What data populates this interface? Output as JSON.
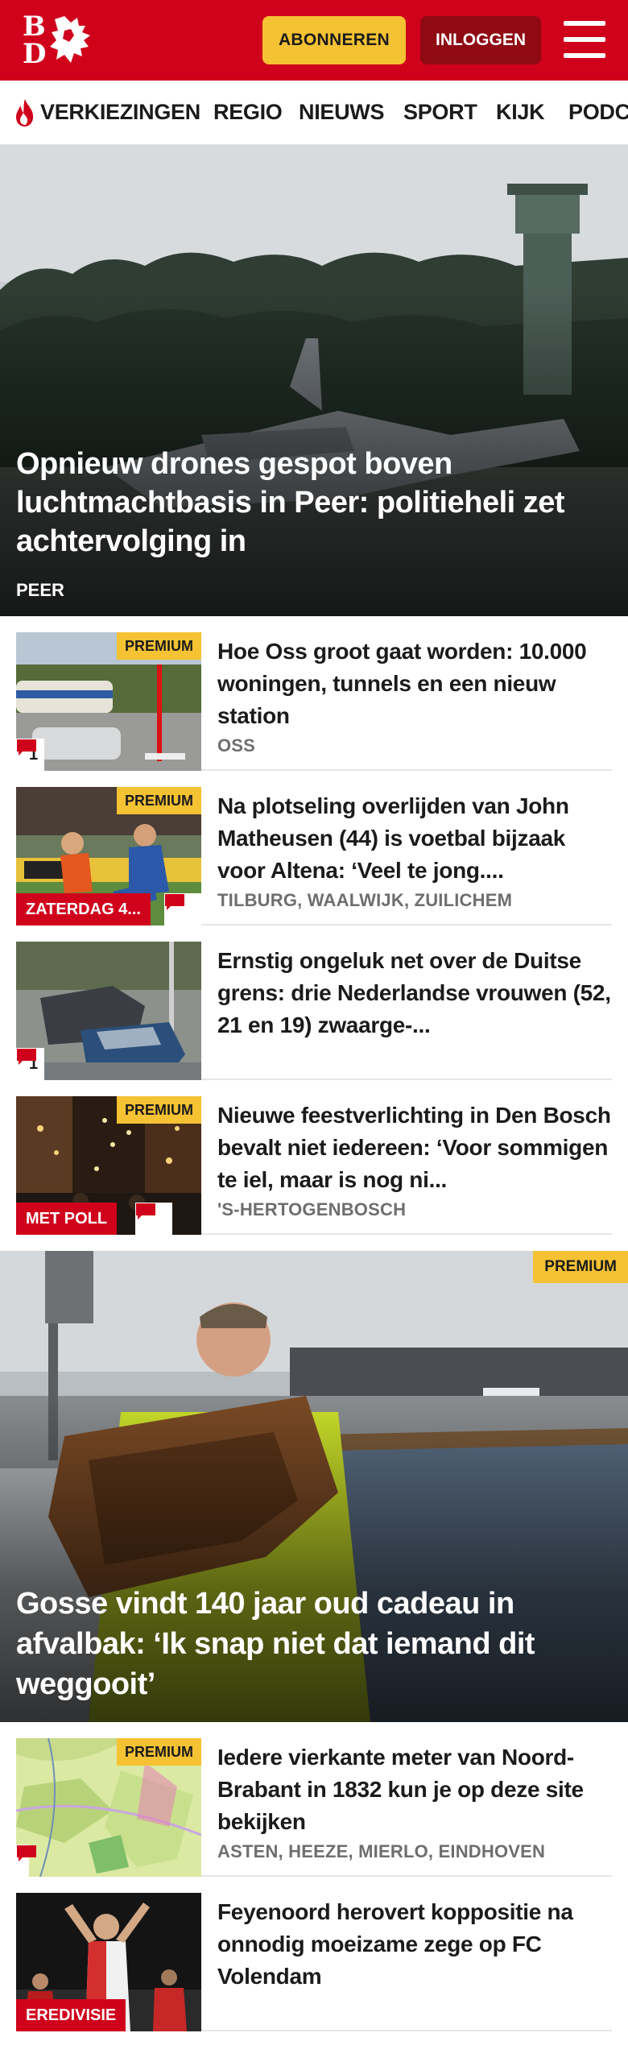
{
  "header": {
    "logo_letters": [
      "B",
      "D"
    ],
    "subscribe_label": "ABONNEREN",
    "login_label": "INLOGGEN",
    "menu_icon": "hamburger-menu-icon"
  },
  "nav": {
    "items": [
      "VERKIEZINGEN",
      "REGIO",
      "NIEUWS",
      "SPORT",
      "KIJK",
      "PODC"
    ],
    "first_item_icon": "flame-icon"
  },
  "hero": {
    "title": "Opnieuw drones gespot boven luchtmachtbasis in Peer: politieheli zet achtervolging in",
    "place": "PEER"
  },
  "articles": [
    {
      "title": "Hoe Oss groot gaat worden: 10.000 woningen, tunnels en een nieuw station",
      "place": "OSS",
      "premium": "PREMIUM",
      "comments": "1"
    },
    {
      "title": "Na plotseling overlijden van John Matheusen (44) is voetbal bijzaak voor Altena: ‘Veel te jong....",
      "place": "TILBURG, WAALWIJK, ZUILICHEM",
      "premium": "PREMIUM",
      "label": "ZATERDAG 4..."
    },
    {
      "title": "Ernstig ongeluk net over de Duitse grens: drie Nederlandse vrouwen (52, 21 en 19) zwaarge-...",
      "comments": "1"
    },
    {
      "title": "Nieuwe feestverlichting in Den Bosch bevalt niet iedereen: ‘Voor sommigen te iel, maar is nog ni...",
      "place": "'S-HERTOGENBOSCH",
      "premium": "PREMIUM",
      "label": "MET POLL"
    }
  ],
  "feature": {
    "title": "Gosse vindt 140 jaar oud cadeau in afvalbak: ‘Ik snap niet dat iemand dit weggooit’",
    "premium": "PREMIUM"
  },
  "articles2": [
    {
      "title": "Iedere vierkante meter van Noord-Brabant in 1832 kun je op deze site bekijken",
      "place": "ASTEN, HEEZE, MIERLO, EINDHOVEN",
      "premium": "PREMIUM"
    },
    {
      "title": "Feyenoord herovert koppositie na onnodig moeizame zege op FC Volendam",
      "label": "EREDIVISIE"
    }
  ],
  "colors": {
    "brand_red": "#d0021b",
    "login_dark_red": "#8f0a13",
    "premium_yellow": "#f5c233",
    "meta_gray": "#6e6e6e"
  }
}
